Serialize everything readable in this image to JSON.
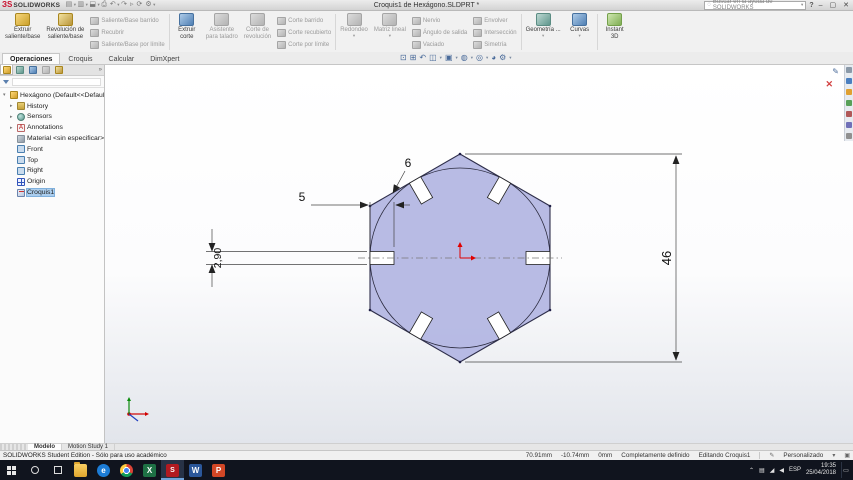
{
  "titlebar": {
    "logo_mark": "ЗS",
    "logo_text": "SOLIDWORKS",
    "title": "Croquis1 de Hexágono.SLDPRT *",
    "search": "Buscar en la ayuda de SOLIDWORKS",
    "help": "?"
  },
  "tabs": {
    "operations": "Operaciones",
    "sketch": "Croquis",
    "evaluate": "Calcular",
    "dimxpert": "DimXpert"
  },
  "ribbon": {
    "extrude_boss": "Extruir\nsaliente/base",
    "revolve_boss": "Revolución de\nsaliente/base",
    "swept_boss": "Saliente/Base barrido",
    "loft_boss": "Recubrir",
    "boundary_boss": "Saliente/Base por límite",
    "extrude_cut": "Extruir\ncorte",
    "hole_wizard": "Asistente\npara taladro",
    "revolve_cut": "Corte de\nrevolución",
    "swept_cut": "Corte barrido",
    "loft_cut": "Corte recubierto",
    "boundary_cut": "Corte por límite",
    "fillet": "Redondeo",
    "pattern": "Matriz lineal",
    "rib": "Nervio",
    "draft": "Ángulo de salida",
    "shell": "Vaciado",
    "wrap": "Envolver",
    "intersect": "Intersección",
    "mirror": "Simetría",
    "refgeo": "Geometría ...",
    "curves": "Curvas",
    "instant3d": "Instant\n3D"
  },
  "panel": {
    "tree": [
      {
        "label": "Hexágono (Default<<Default>"
      },
      {
        "label": "History"
      },
      {
        "label": "Sensors"
      },
      {
        "label": "Annotations"
      },
      {
        "label": "Material <sin especificar>"
      },
      {
        "label": "Front"
      },
      {
        "label": "Top"
      },
      {
        "label": "Right"
      },
      {
        "label": "Origin"
      },
      {
        "label": "Croquis1"
      }
    ]
  },
  "sketch": {
    "dim_height": "46",
    "dim_slot_length": "5",
    "dim_slot_width": "2,90",
    "dim_notch": "6"
  },
  "docktabs": {
    "model": "Modelo",
    "motion": "Motion Study 1"
  },
  "statusbar": {
    "left": "SOLIDWORKS Student Edition - Sólo para uso académico",
    "x": "70.91mm",
    "y": "-10.74mm",
    "z": "0mm",
    "state": "Completamente definido",
    "mode": "Editando Croquis1",
    "profile": "Personalizado"
  },
  "taskbar": {
    "lang": "ESP",
    "time": "19:35",
    "date": "25/04/2018"
  }
}
